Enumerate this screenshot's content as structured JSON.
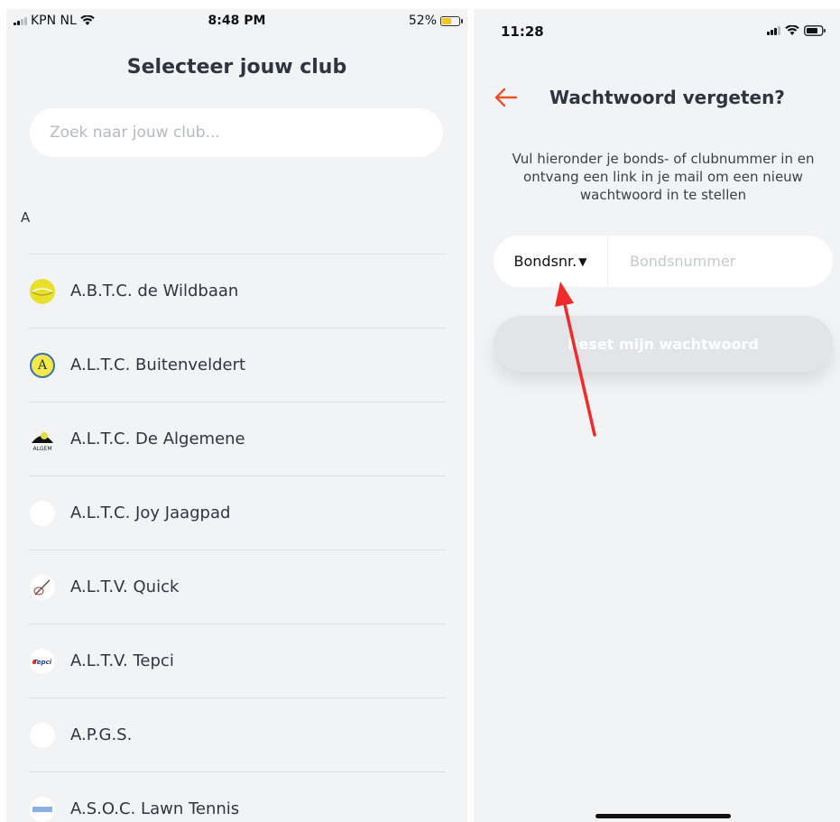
{
  "left_screen": {
    "status_bar": {
      "carrier": "KPN NL",
      "time": "8:48 PM",
      "battery": "52%"
    },
    "title": "Selecteer jouw club",
    "search": {
      "placeholder": "Zoek naar jouw club...",
      "value": ""
    },
    "section_letter": "A",
    "clubs": [
      {
        "name": "A.B.T.C. de Wildbaan"
      },
      {
        "name": "A.L.T.C. Buitenveldert"
      },
      {
        "name": "A.L.T.C. De Algemene"
      },
      {
        "name": "A.L.T.C. Joy Jaagpad"
      },
      {
        "name": "A.L.T.V. Quick"
      },
      {
        "name": "A.L.T.V. Tepci"
      },
      {
        "name": "A.P.G.S."
      },
      {
        "name": "A.S.O.C. Lawn Tennis"
      }
    ],
    "logo_texts": {
      "algemene": "ALGEM",
      "tepci": "Tepci"
    }
  },
  "right_screen": {
    "status_bar": {
      "time": "11:28"
    },
    "title": "Wachtwoord vergeten?",
    "description": "Vul hieronder je bonds- of clubnummer in en ontvang een link in je mail om een nieuw wachtwoord in te stellen",
    "number_type": {
      "selected": "Bondsnr.",
      "arrow": "▼"
    },
    "number_input": {
      "placeholder": "Bondsnummer",
      "value": ""
    },
    "reset_button": "Reset mijn wachtwoord",
    "accent_color": "#e8532e",
    "annotation_color": "#f02a2a"
  }
}
